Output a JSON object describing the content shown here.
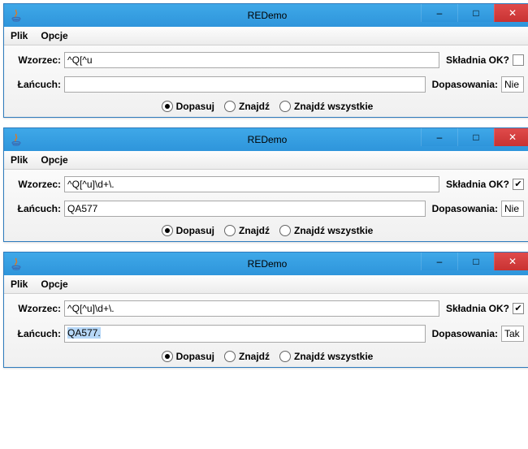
{
  "windows": [
    {
      "title": "REDemo",
      "menu": {
        "file": "Plik",
        "options": "Opcje"
      },
      "patternLabel": "Wzorzec:",
      "patternValue": "^Q[^u",
      "syntaxLabel": "Składnia OK?",
      "syntaxChecked": false,
      "stringLabel": "Łańcuch:",
      "stringValue": "",
      "stringHighlight": "",
      "matchLabel": "Dopasowania:",
      "matchValue": "Nie",
      "radios": {
        "match": "Dopasuj",
        "find": "Znajdź",
        "findAll": "Znajdź wszystkie"
      },
      "selectedRadio": "match"
    },
    {
      "title": "REDemo",
      "menu": {
        "file": "Plik",
        "options": "Opcje"
      },
      "patternLabel": "Wzorzec:",
      "patternValue": "^Q[^u]\\d+\\.",
      "syntaxLabel": "Składnia OK?",
      "syntaxChecked": true,
      "stringLabel": "Łańcuch:",
      "stringValue": "QA577",
      "stringHighlight": "",
      "matchLabel": "Dopasowania:",
      "matchValue": "Nie",
      "radios": {
        "match": "Dopasuj",
        "find": "Znajdź",
        "findAll": "Znajdź wszystkie"
      },
      "selectedRadio": "match"
    },
    {
      "title": "REDemo",
      "menu": {
        "file": "Plik",
        "options": "Opcje"
      },
      "patternLabel": "Wzorzec:",
      "patternValue": "^Q[^u]\\d+\\.",
      "syntaxLabel": "Składnia OK?",
      "syntaxChecked": true,
      "stringLabel": "Łańcuch:",
      "stringValue": "QA577.",
      "stringHighlight": "QA577.",
      "matchLabel": "Dopasowania:",
      "matchValue": "Tak",
      "radios": {
        "match": "Dopasuj",
        "find": "Znajdź",
        "findAll": "Znajdź wszystkie"
      },
      "selectedRadio": "match"
    }
  ],
  "icons": {
    "minimize": "–",
    "maximize": "□",
    "close": "✕",
    "check": "✔"
  }
}
